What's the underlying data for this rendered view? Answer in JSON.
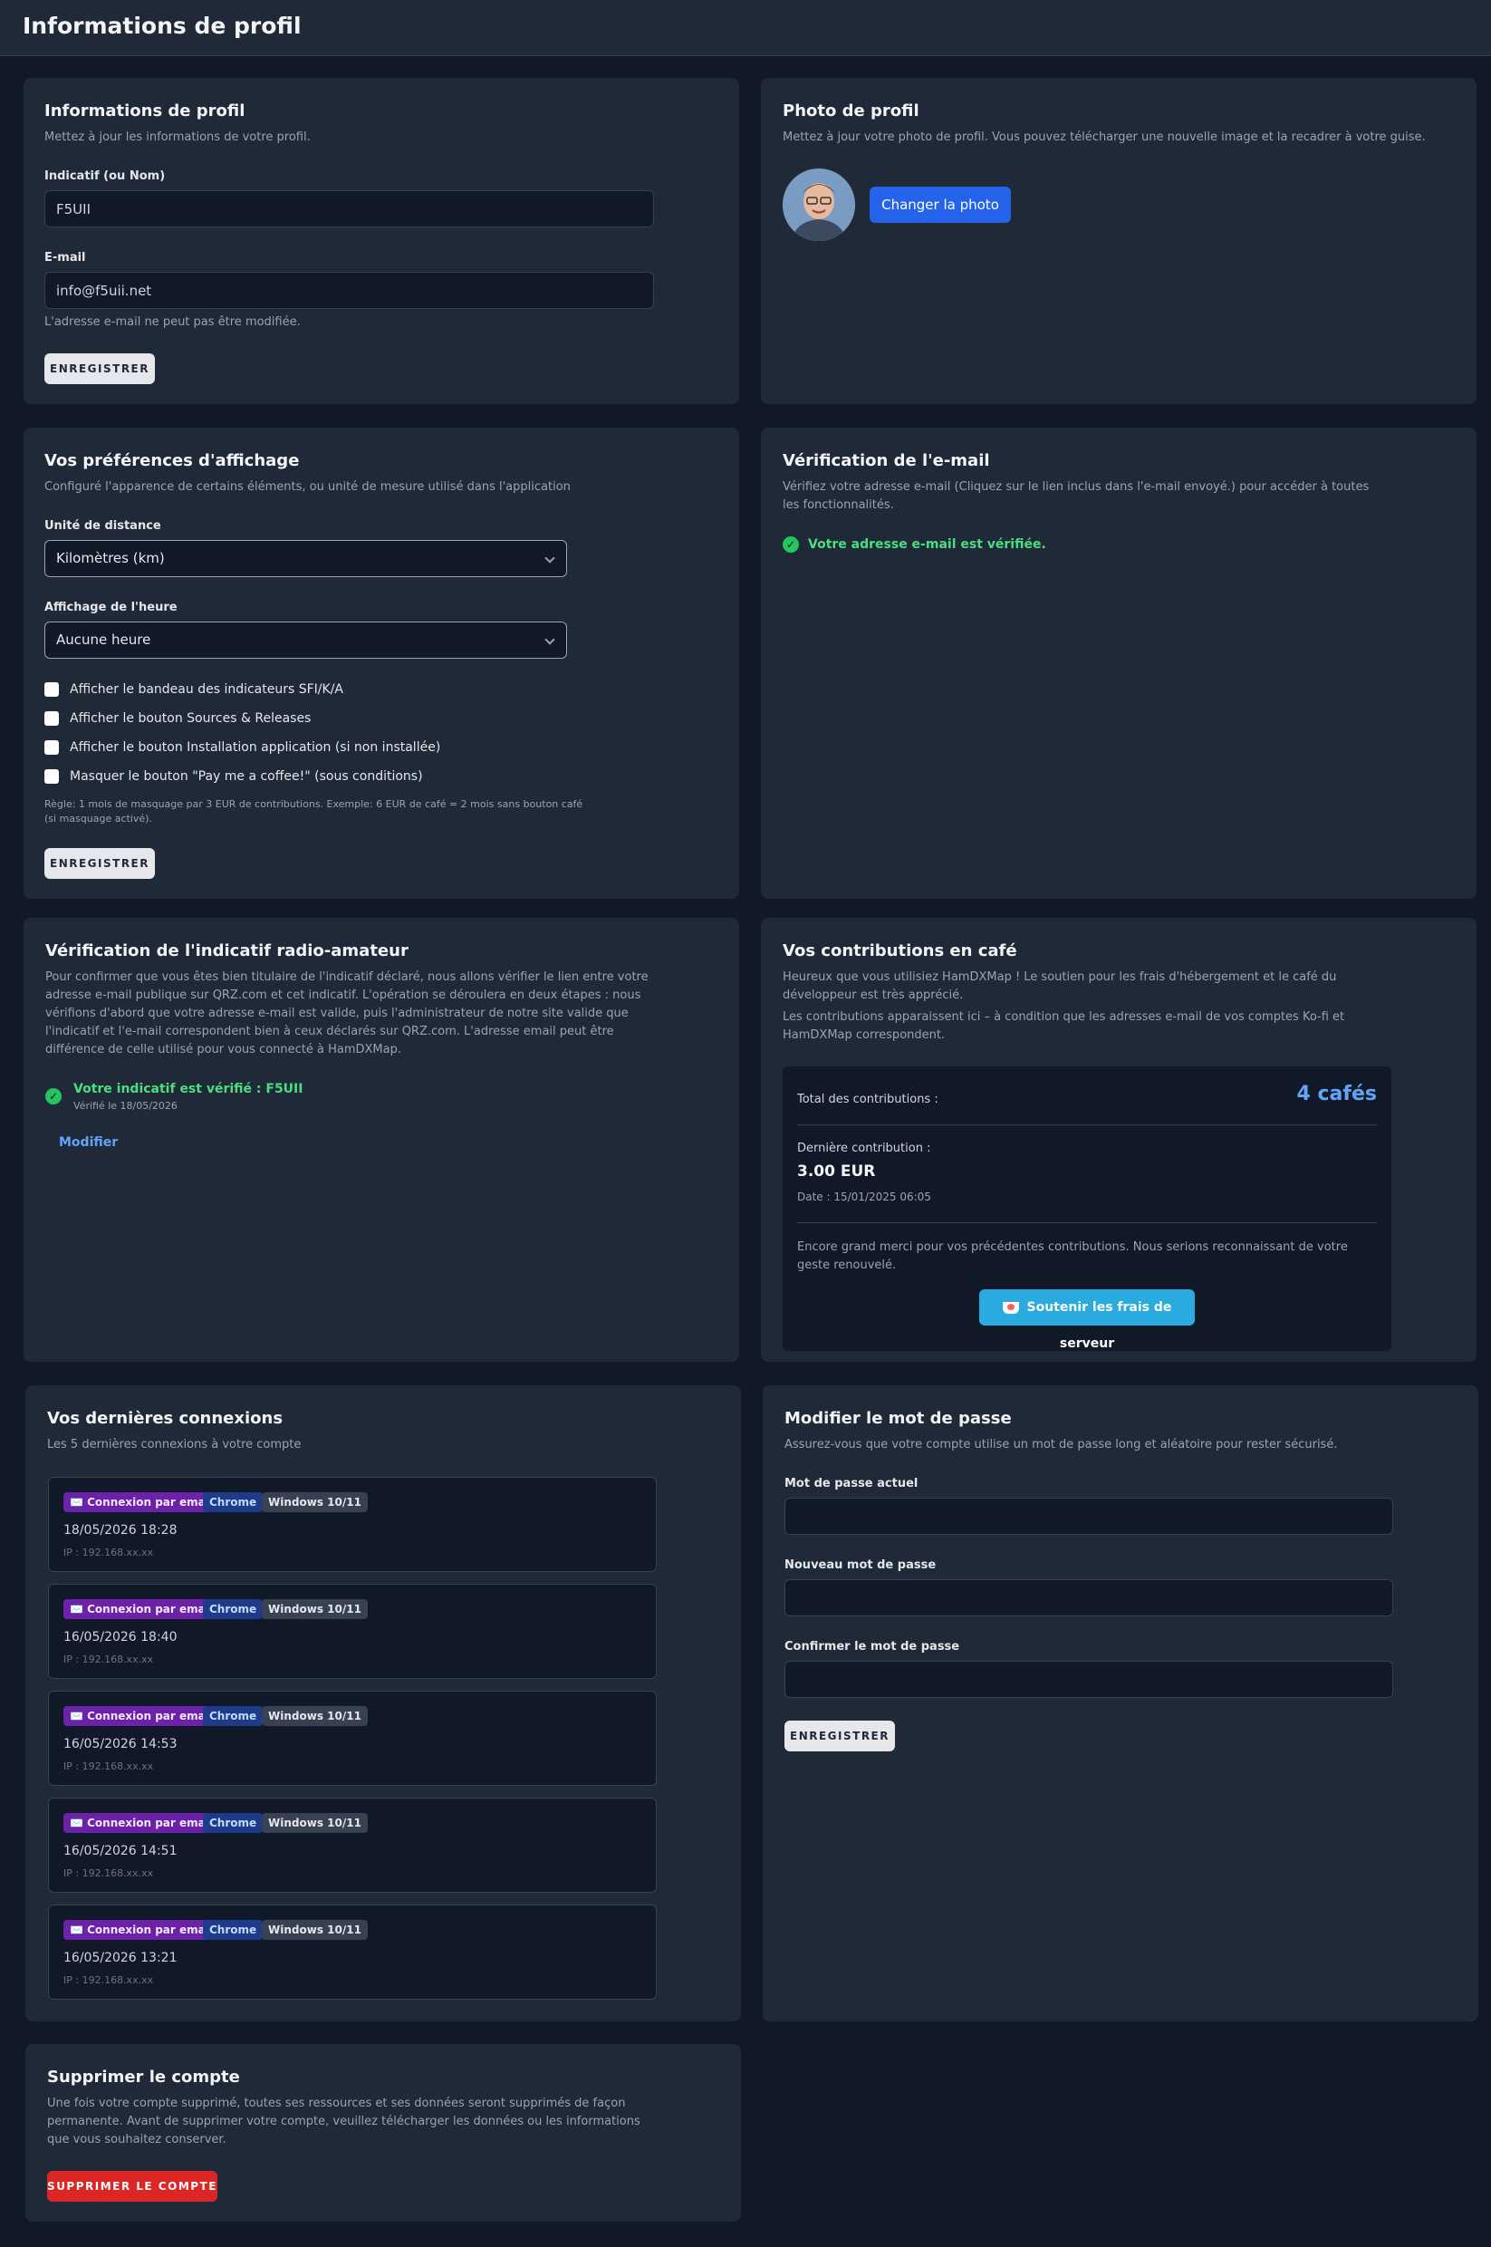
{
  "header": {
    "title": "Informations de profil"
  },
  "profile_info": {
    "title": "Informations de profil",
    "subtitle": "Mettez à jour les informations de votre profil.",
    "callsign_label": "Indicatif (ou Nom)",
    "callsign_value": "F5UII",
    "email_label": "E-mail",
    "email_value": "info@f5uii.net",
    "email_note": "L'adresse e-mail ne peut pas être modifiée.",
    "save_label": "ENREGISTRER"
  },
  "photo": {
    "title": "Photo de profil",
    "subtitle": "Mettez à jour votre photo de profil. Vous pouvez télécharger une nouvelle image et la recadrer à votre guise.",
    "change_label": "Changer la photo"
  },
  "display_prefs": {
    "title": "Vos préférences d'affichage",
    "subtitle": "Configuré l'apparence de certains éléments, ou unité de mesure utilisé dans l'application",
    "distance_label": "Unité de distance",
    "distance_value": "Kilomètres (km)",
    "time_label": "Affichage de l'heure",
    "time_value": "Aucune heure",
    "checkboxes": [
      "Afficher le bandeau des indicateurs SFI/K/A",
      "Afficher le bouton Sources & Releases",
      "Afficher le bouton Installation application (si non installée)",
      "Masquer le bouton \"Pay me a coffee!\" (sous conditions)"
    ],
    "rule_line1": "Règle: 1 mois de masquage par 3 EUR de contributions. Exemple: 6 EUR de café = 2 mois sans bouton café",
    "rule_line2": "(si masquage activé).",
    "save_label": "ENREGISTRER"
  },
  "email_verif": {
    "title": "Vérification de l'e-mail",
    "subtitle": "Vérifiez votre adresse e-mail (Cliquez sur le lien inclus dans l'e-mail envoyé.) pour accéder à toutes les fonctionnalités.",
    "status": "Votre adresse e-mail est vérifiée."
  },
  "callsign_verif": {
    "title": "Vérification de l'indicatif radio-amateur",
    "description": "Pour confirmer que vous êtes bien titulaire de l'indicatif déclaré, nous allons vérifier le lien entre votre adresse e-mail publique sur QRZ.com et cet indicatif. L'opération se déroulera en deux étapes : nous vérifions d'abord que votre adresse e-mail est valide, puis l'administrateur de notre site valide que l'indicatif et l'e-mail correspondent bien à ceux déclarés sur QRZ.com. L'adresse email peut être différence de celle utilisé pour vous connecté à HamDXMap.",
    "status": "Votre indicatif est vérifié : F5UII",
    "verified_date": "Vérifié le 18/05/2026",
    "modify_label": "Modifier"
  },
  "contributions": {
    "title": "Vos contributions en café",
    "intro1": "Heureux que vous utilisiez HamDXMap ! Le soutien pour les frais d'hébergement et le café du développeur est très apprécié.",
    "intro2": "Les contributions apparaissent ici – à condition que les adresses e-mail de vos comptes Ko-fi et HamDXMap correspondent.",
    "total_label": "Total des contributions :",
    "total_value": "4 cafés",
    "last_label": "Dernière contribution :",
    "last_amount": "3.00 EUR",
    "last_date": "Date : 15/01/2025 06:05",
    "thanks": "Encore grand merci pour vos précédentes contributions. Nous serions reconnaissant de votre geste renouvelé.",
    "support_label": "Soutenir les frais de serveur"
  },
  "connections": {
    "title": "Vos dernières connexions",
    "subtitle": "Les 5 dernières connexions à votre compte",
    "items": [
      {
        "type": "✉️ Connexion par email",
        "browser": "Chrome",
        "os": "Windows 10/11",
        "date": "18/05/2026 18:28",
        "ip": "IP : 192.168.xx.xx"
      },
      {
        "type": "✉️ Connexion par email",
        "browser": "Chrome",
        "os": "Windows 10/11",
        "date": "16/05/2026 18:40",
        "ip": "IP : 192.168.xx.xx"
      },
      {
        "type": "✉️ Connexion par email",
        "browser": "Chrome",
        "os": "Windows 10/11",
        "date": "16/05/2026 14:53",
        "ip": "IP : 192.168.xx.xx"
      },
      {
        "type": "✉️ Connexion par email",
        "browser": "Chrome",
        "os": "Windows 10/11",
        "date": "16/05/2026 14:51",
        "ip": "IP : 192.168.xx.xx"
      },
      {
        "type": "✉️ Connexion par email",
        "browser": "Chrome",
        "os": "Windows 10/11",
        "date": "16/05/2026 13:21",
        "ip": "IP : 192.168.xx.xx"
      }
    ]
  },
  "password": {
    "title": "Modifier le mot de passe",
    "subtitle": "Assurez-vous que votre compte utilise un mot de passe long et aléatoire pour rester sécurisé.",
    "current_label": "Mot de passe actuel",
    "new_label": "Nouveau mot de passe",
    "confirm_label": "Confirmer le mot de passe",
    "save_label": "ENREGISTRER"
  },
  "delete": {
    "title": "Supprimer le compte",
    "description": "Une fois votre compte supprimé, toutes ses ressources et ses données seront supprimés de façon permanente. Avant de supprimer votre compte, veuillez télécharger les données ou les informations que vous souhaitez conserver.",
    "button_label": "SUPPRIMER LE COMPTE"
  },
  "colors": {
    "accent": "#2563eb",
    "success": "#4ade80",
    "danger": "#dc2626",
    "kofi": "#29abe0",
    "card": "#1f2937",
    "background": "#111827"
  },
  "icons": {
    "check": "check-circle-icon",
    "chevron": "chevron-down-icon",
    "mail": "envelope-icon",
    "cup": "coffee-cup-icon"
  }
}
